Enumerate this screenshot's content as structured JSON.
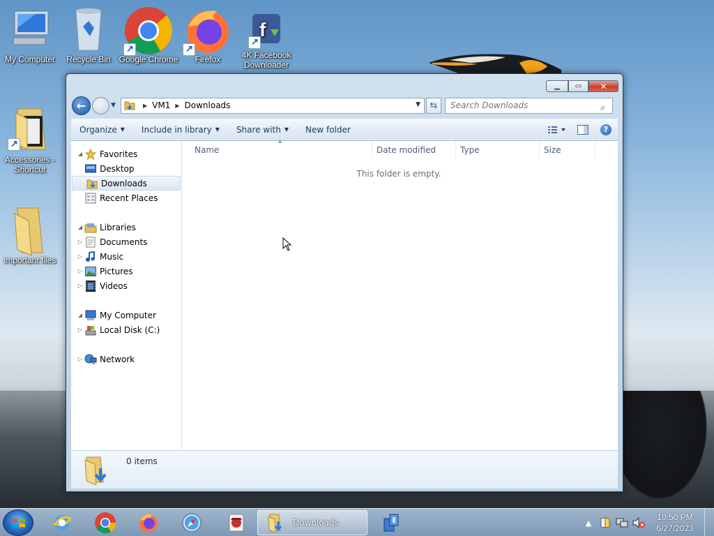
{
  "desktop": {
    "icons": [
      {
        "label": "My Computer",
        "icon": "computer-icon",
        "shortcut": false
      },
      {
        "label": "Recycle Bin",
        "icon": "recycle-bin-icon",
        "shortcut": false
      },
      {
        "label": "Google Chrome",
        "icon": "chrome-icon",
        "shortcut": true
      },
      {
        "label": "Firefox",
        "icon": "firefox-icon",
        "shortcut": true
      },
      {
        "label": "4K Facebook Downloader",
        "icon": "facebook-downloader-icon",
        "shortcut": true
      },
      {
        "label": "Accessories - Shortcut",
        "icon": "folder-icon",
        "shortcut": true
      },
      {
        "label": "important files",
        "icon": "folder-icon",
        "shortcut": false
      }
    ]
  },
  "window": {
    "title": "Downloads",
    "controls": {
      "minimize": "minimize-icon",
      "maximize": "maximize-icon",
      "close": "close-icon"
    },
    "address": {
      "crumbs": [
        "VM1",
        "Downloads"
      ]
    },
    "search": {
      "placeholder": "Search Downloads"
    },
    "toolbar": {
      "organize": "Organize",
      "include_in_library": "Include in library",
      "share_with": "Share with",
      "new_folder": "New folder"
    },
    "nav": {
      "favorites": "Favorites",
      "desktop": "Desktop",
      "downloads": "Downloads",
      "recent_places": "Recent Places",
      "libraries": "Libraries",
      "documents": "Documents",
      "music": "Music",
      "pictures": "Pictures",
      "videos": "Videos",
      "my_computer": "My Computer",
      "local_disk": "Local Disk (C:)",
      "network": "Network",
      "selected": "Downloads"
    },
    "columns": [
      "Name",
      "Date modified",
      "Type",
      "Size"
    ],
    "empty_message": "This folder is empty.",
    "details": {
      "item_count": "0 items"
    }
  },
  "taskbar": {
    "apps": [
      "Internet Explorer",
      "Google Chrome",
      "Firefox",
      "Safari",
      "Spy app",
      "Downloads",
      "Network app"
    ],
    "active_label": "Downloads",
    "clock": {
      "time": "10:50 PM",
      "date": "6/27/2023"
    }
  },
  "colors": {
    "accent": "#1f5aa8",
    "selected_bg": "#dbe7f3",
    "close_red": "#c7432f"
  }
}
